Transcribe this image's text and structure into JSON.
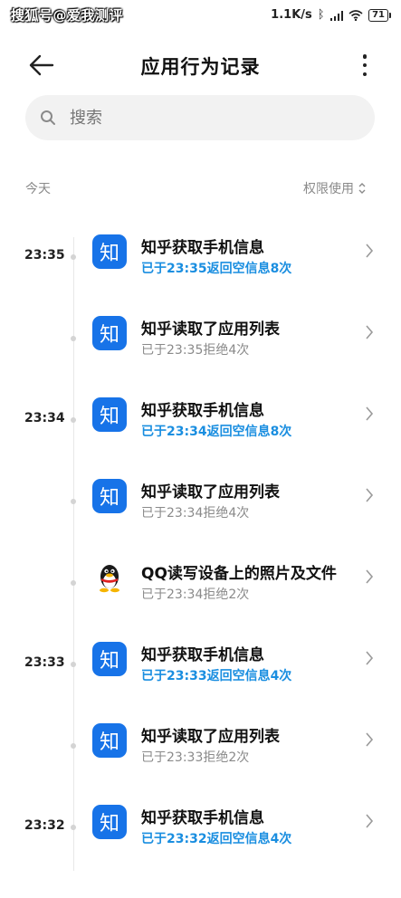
{
  "status_bar": {
    "watermark": "搜狐号@爱我测评",
    "speed": "1.1K/s",
    "battery": "71"
  },
  "header": {
    "title": "应用行为记录"
  },
  "search": {
    "placeholder": "搜索"
  },
  "section": {
    "label": "今天",
    "sort_label": "权限使用"
  },
  "entries": [
    {
      "time": "23:35",
      "app": "zhihu",
      "icon_text": "知",
      "title": "知乎获取手机信息",
      "detail": "已于23:35返回空信息8次",
      "detail_style": "blue"
    },
    {
      "time": "",
      "app": "zhihu",
      "icon_text": "知",
      "title": "知乎读取了应用列表",
      "detail": "已于23:35拒绝4次",
      "detail_style": "gray"
    },
    {
      "time": "23:34",
      "app": "zhihu",
      "icon_text": "知",
      "title": "知乎获取手机信息",
      "detail": "已于23:34返回空信息8次",
      "detail_style": "blue"
    },
    {
      "time": "",
      "app": "zhihu",
      "icon_text": "知",
      "title": "知乎读取了应用列表",
      "detail": "已于23:34拒绝4次",
      "detail_style": "gray"
    },
    {
      "time": "",
      "app": "qq",
      "icon_text": "",
      "title": "QQ读写设备上的照片及文件",
      "detail": "已于23:34拒绝2次",
      "detail_style": "gray"
    },
    {
      "time": "23:33",
      "app": "zhihu",
      "icon_text": "知",
      "title": "知乎获取手机信息",
      "detail": "已于23:33返回空信息4次",
      "detail_style": "blue"
    },
    {
      "time": "",
      "app": "zhihu",
      "icon_text": "知",
      "title": "知乎读取了应用列表",
      "detail": "已于23:33拒绝2次",
      "detail_style": "gray"
    },
    {
      "time": "23:32",
      "app": "zhihu",
      "icon_text": "知",
      "title": "知乎获取手机信息",
      "detail": "已于23:32返回空信息4次",
      "detail_style": "blue"
    }
  ],
  "colors": {
    "zhihu_blue": "#1773e8",
    "detail_blue": "#1a8ee0",
    "detail_gray": "#8a8a8a"
  }
}
